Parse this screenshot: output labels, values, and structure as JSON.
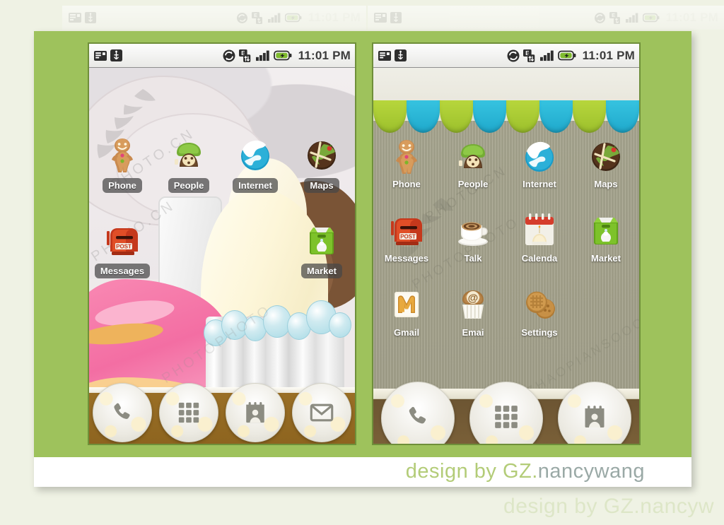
{
  "page": {
    "background_color": "#eff2e4",
    "card_color": "#9ec25c",
    "credit_main": "design by  GZ.",
    "credit_name": "nancywang",
    "credit_ghost": "design by  GZ.nancyw",
    "watermark_text": "PHOTO.CN",
    "watermark_text2": "PHOTOPHOTO",
    "watermark_text3": "ZHAOPIANSOOO"
  },
  "status_bar": {
    "time": "11:01 PM",
    "left_icons": [
      "sim-card-icon",
      "usb-icon"
    ],
    "right_icons": [
      "sync-icon",
      "edge-data-icon",
      "signal-bars-icon",
      "battery-charging-icon"
    ]
  },
  "phones": [
    {
      "id": "left",
      "name": "gingerbread-dessert-theme-home",
      "wallpaper": "ice-cream-dessert-illustration",
      "label_style": "pill",
      "rows": [
        [
          {
            "label": "Phone",
            "icon": "gingerbread-man-icon"
          },
          {
            "label": "People",
            "icon": "cookie-telephone-icon"
          },
          {
            "label": "Internet",
            "icon": "snow-globe-icon"
          },
          {
            "label": "Maps",
            "icon": "chocolate-map-cookie-icon"
          }
        ],
        [
          {
            "label": "Messages",
            "icon": "red-mailbox-icon"
          },
          {
            "label": "",
            "icon": ""
          },
          {
            "label": "",
            "icon": ""
          },
          {
            "label": "Market",
            "icon": "green-shopping-bag-icon"
          }
        ]
      ],
      "dock": [
        {
          "icon": "phone-handset-icon",
          "name": "dock-phone"
        },
        {
          "icon": "app-grid-icon",
          "name": "dock-all-apps"
        },
        {
          "icon": "contact-card-icon",
          "name": "dock-contacts"
        },
        {
          "icon": "envelope-icon",
          "name": "dock-messaging"
        }
      ]
    },
    {
      "id": "right",
      "name": "gingerbread-awning-theme-home",
      "wallpaper": "striped-khaki-with-awning",
      "label_style": "plain",
      "awning_colors": [
        "#a8c832",
        "#29b8d8",
        "#a8c832",
        "#29b8d8",
        "#a8c832",
        "#29b8d8",
        "#a8c832",
        "#29b8d8"
      ],
      "rows": [
        [
          {
            "label": "Phone",
            "icon": "gingerbread-man-icon"
          },
          {
            "label": "People",
            "icon": "cookie-telephone-icon"
          },
          {
            "label": "Internet",
            "icon": "snow-globe-icon"
          },
          {
            "label": "Maps",
            "icon": "chocolate-map-cookie-icon"
          }
        ],
        [
          {
            "label": "Messages",
            "icon": "red-mailbox-icon"
          },
          {
            "label": "Talk",
            "icon": "coffee-cup-icon"
          },
          {
            "label": "Calenda",
            "icon": "calendar-cupcake-icon"
          },
          {
            "label": "Market",
            "icon": "green-shopping-bag-icon"
          }
        ],
        [
          {
            "label": "Gmail",
            "icon": "gmail-m-icon"
          },
          {
            "label": "Emai",
            "icon": "cupcake-at-sign-icon"
          },
          {
            "label": "Settings",
            "icon": "cookies-stack-icon"
          },
          {
            "label": "",
            "icon": ""
          }
        ]
      ],
      "dock": [
        {
          "icon": "phone-handset-icon",
          "name": "dock-phone"
        },
        {
          "icon": "app-grid-icon",
          "name": "dock-all-apps"
        },
        {
          "icon": "contact-card-icon",
          "name": "dock-contacts"
        }
      ]
    }
  ]
}
